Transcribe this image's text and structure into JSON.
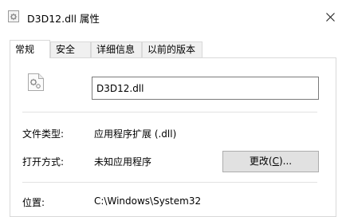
{
  "window": {
    "title": "D3D12.dll 属性",
    "icon": "dll-file-icon",
    "close_icon": "close-icon"
  },
  "tabs": [
    {
      "label": "常规",
      "active": true
    },
    {
      "label": "安全",
      "active": false
    },
    {
      "label": "详细信息",
      "active": false
    },
    {
      "label": "以前的版本",
      "active": false
    }
  ],
  "general": {
    "file_name": "D3D12.dll",
    "file_type_label": "文件类型:",
    "file_type_value": "应用程序扩展 (.dll)",
    "opens_with_label": "打开方式:",
    "opens_with_value": "未知应用程序",
    "change_button": {
      "prefix": "更改(",
      "accel": "C",
      "suffix": ")..."
    },
    "location_label": "位置:",
    "location_value": "C:\\Windows\\System32"
  }
}
